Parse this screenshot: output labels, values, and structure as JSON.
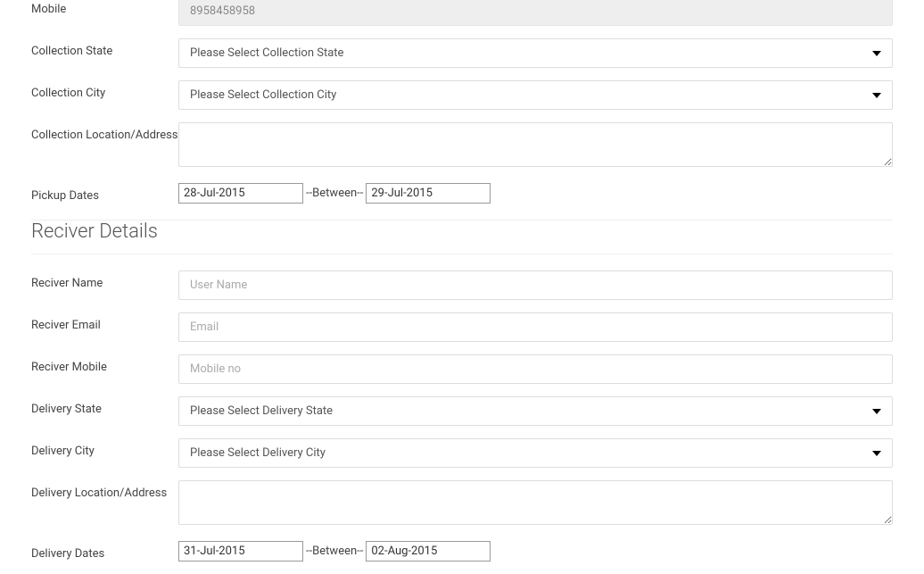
{
  "sender": {
    "mobile_label": "Mobile",
    "mobile_value": "8958458958",
    "collection_state_label": "Collection State",
    "collection_state_placeholder": "Please Select Collection State",
    "collection_city_label": "Collection City",
    "collection_city_placeholder": "Please Select Collection City",
    "collection_address_label": "Collection Location/Address",
    "pickup_dates_label": "Pickup Dates",
    "pickup_date_from": "28-Jul-2015",
    "pickup_date_to": "29-Jul-2015",
    "between_text": "--Between--"
  },
  "receiver": {
    "section_title": "Reciver Details",
    "name_label": "Reciver Name",
    "name_placeholder": "User Name",
    "email_label": "Reciver Email",
    "email_placeholder": "Email",
    "mobile_label": "Reciver Mobile",
    "mobile_placeholder": "Mobile no",
    "delivery_state_label": "Delivery State",
    "delivery_state_placeholder": "Please Select Delivery State",
    "delivery_city_label": "Delivery City",
    "delivery_city_placeholder": "Please Select Delivery City",
    "delivery_address_label": "Delivery Location/Address",
    "delivery_dates_label": "Delivery Dates",
    "delivery_date_from": "31-Jul-2015",
    "delivery_date_to": "02-Aug-2015",
    "between_text": "--Between--"
  }
}
